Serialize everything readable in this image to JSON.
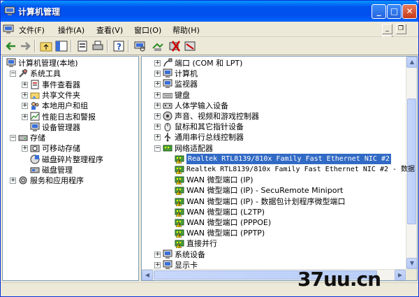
{
  "window": {
    "title": "计算机管理"
  },
  "menu": [
    {
      "label": "文件(F)"
    },
    {
      "label": "操作(A)"
    },
    {
      "label": "查看(V)"
    },
    {
      "label": "窗口(O)"
    },
    {
      "label": "帮助(H)"
    }
  ],
  "left_tree": [
    {
      "label": "计算机管理(本地)",
      "icon": "computer-management-icon",
      "expander": "",
      "level": 0
    },
    {
      "label": "系统工具",
      "icon": "tools-icon",
      "expander": "−",
      "level": 1
    },
    {
      "label": "事件查看器",
      "icon": "event-viewer-icon",
      "expander": "+",
      "level": 2
    },
    {
      "label": "共享文件夹",
      "icon": "shared-folder-icon",
      "expander": "+",
      "level": 2
    },
    {
      "label": "本地用户和组",
      "icon": "users-icon",
      "expander": "+",
      "level": 2
    },
    {
      "label": "性能日志和警报",
      "icon": "performance-icon",
      "expander": "+",
      "level": 2
    },
    {
      "label": "设备管理器",
      "icon": "device-manager-icon",
      "expander": "",
      "level": 2
    },
    {
      "label": "存储",
      "icon": "storage-icon",
      "expander": "−",
      "level": 1
    },
    {
      "label": "可移动存储",
      "icon": "removable-storage-icon",
      "expander": "+",
      "level": 2
    },
    {
      "label": "磁盘碎片整理程序",
      "icon": "defrag-icon",
      "expander": "",
      "level": 2
    },
    {
      "label": "磁盘管理",
      "icon": "disk-management-icon",
      "expander": "",
      "level": 2
    },
    {
      "label": "服务和应用程序",
      "icon": "services-icon",
      "expander": "+",
      "level": 1
    }
  ],
  "right_tree": [
    {
      "label": "端口 (COM 和 LPT)",
      "icon": "port-icon",
      "expander": "+",
      "level": 0
    },
    {
      "label": "计算机",
      "icon": "computer-icon",
      "expander": "+",
      "level": 0
    },
    {
      "label": "监视器",
      "icon": "monitor-icon",
      "expander": "+",
      "level": 0
    },
    {
      "label": "键盘",
      "icon": "keyboard-icon",
      "expander": "+",
      "level": 0
    },
    {
      "label": "人体学输入设备",
      "icon": "hid-icon",
      "expander": "+",
      "level": 0
    },
    {
      "label": "声音、视频和游戏控制器",
      "icon": "sound-icon",
      "expander": "+",
      "level": 0
    },
    {
      "label": "鼠标和其它指针设备",
      "icon": "mouse-icon",
      "expander": "+",
      "level": 0
    },
    {
      "label": "通用串行总线控制器",
      "icon": "usb-icon",
      "expander": "+",
      "level": 0
    },
    {
      "label": "网络适配器",
      "icon": "network-adapter-icon",
      "expander": "−",
      "level": 0
    },
    {
      "label": "Realtek RTL8139/810x Family Fast Ethernet NIC #2",
      "icon": "warning-nic-icon",
      "expander": "",
      "level": 1,
      "selected": true,
      "mono": true
    },
    {
      "label": "Realtek RTL8139/810x Family Fast Ethernet NIC #2 - 数据",
      "icon": "warning-nic-icon",
      "expander": "",
      "level": 1,
      "mono": true
    },
    {
      "label": "WAN 微型端口 (IP)",
      "icon": "warning-nic-icon",
      "expander": "",
      "level": 1
    },
    {
      "label": "WAN 微型端口 (IP) - SecuRemote Miniport",
      "icon": "warning-nic-icon",
      "expander": "",
      "level": 1
    },
    {
      "label": "WAN 微型端口 (IP) - 数据包计划程序微型端口",
      "icon": "warning-nic-icon",
      "expander": "",
      "level": 1
    },
    {
      "label": "WAN 微型端口 (L2TP)",
      "icon": "warning-nic-icon",
      "expander": "",
      "level": 1
    },
    {
      "label": "WAN 微型端口 (PPPOE)",
      "icon": "warning-nic-icon",
      "expander": "",
      "level": 1
    },
    {
      "label": "WAN 微型端口 (PPTP)",
      "icon": "warning-nic-icon",
      "expander": "",
      "level": 1
    },
    {
      "label": "直接并行",
      "icon": "warning-nic-icon",
      "expander": "",
      "level": 1
    },
    {
      "label": "系统设备",
      "icon": "system-device-icon",
      "expander": "+",
      "level": 0
    },
    {
      "label": "显示卡",
      "icon": "display-adapter-icon",
      "expander": "+",
      "level": 0
    }
  ],
  "watermark": {
    "text": "37uu.cn"
  },
  "colors": {
    "titlebar": "#0053ee",
    "selection": "#316ac5",
    "chrome": "#ece9d8"
  }
}
